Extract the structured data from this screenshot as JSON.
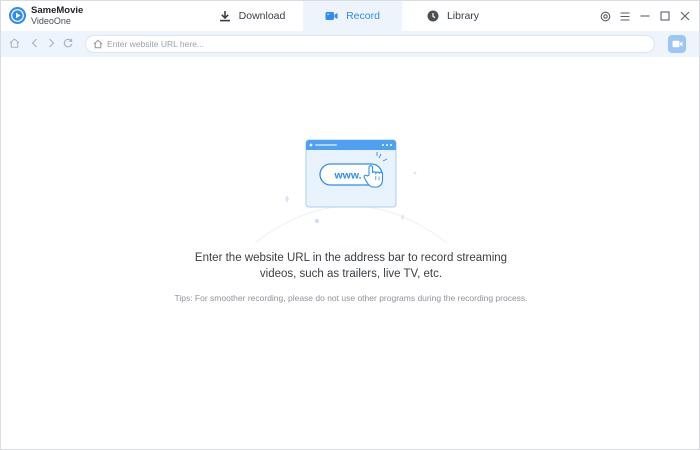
{
  "app": {
    "name_line1": "SameMovie",
    "name_line2": "VideoOne",
    "logo_icon": "play-logo-icon",
    "brand_color": "#2f8cf0"
  },
  "tabs": [
    {
      "label": "Download",
      "icon": "download-icon",
      "active": false
    },
    {
      "label": "Record",
      "icon": "video-camera-icon",
      "active": true
    },
    {
      "label": "Library",
      "icon": "clock-icon",
      "active": false
    }
  ],
  "window_controls": [
    "settings-icon",
    "menu-icon",
    "minimize-icon",
    "maximize-icon",
    "close-icon"
  ],
  "navbar": {
    "buttons": [
      "home-icon",
      "back-icon",
      "forward-icon",
      "refresh-icon"
    ],
    "url_value": "",
    "url_placeholder": "Enter website URL here...",
    "record_button_icon": "record-camera-icon"
  },
  "illustration": {
    "badge_text": "www."
  },
  "main": {
    "message_line1": "Enter the website URL in the address bar to record streaming",
    "message_line2": "videos, such as trailers, live TV, etc.",
    "tips": "Tips: For smoother recording, please do not use other programs during the recording process."
  },
  "colors": {
    "accent": "#2f8cf0",
    "navbar_bg": "#edf4fc",
    "text": "#3a3f45",
    "muted": "#8d949c"
  }
}
